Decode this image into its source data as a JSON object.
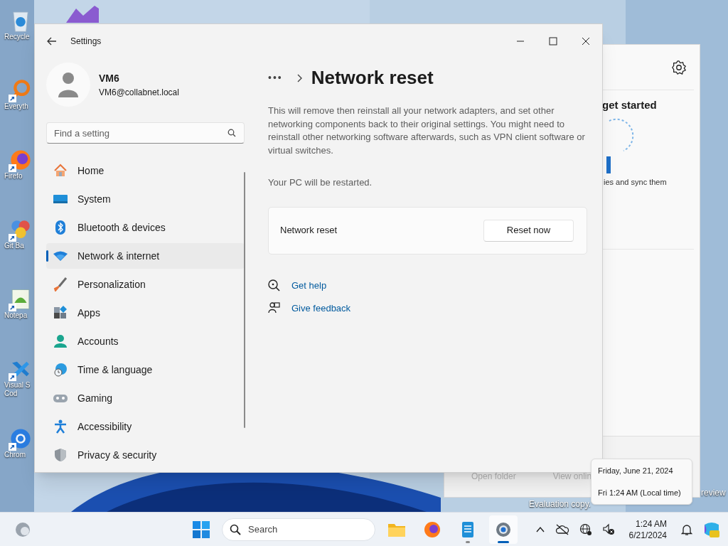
{
  "desktop_icons": [
    {
      "kind": "recycle",
      "lines": [
        "Recycle"
      ]
    },
    {
      "kind": "magnifier",
      "lines": [
        "Everyth"
      ]
    },
    {
      "kind": "firefox",
      "lines": [
        "Firefo"
      ]
    },
    {
      "kind": "git",
      "lines": [
        "Git Ba"
      ]
    },
    {
      "kind": "notepad",
      "lines": [
        "Notepa"
      ]
    },
    {
      "kind": "vscode",
      "lines": [
        "Visual S",
        "Cod"
      ]
    },
    {
      "kind": "chrome",
      "lines": [
        "Chrom"
      ]
    }
  ],
  "background_window": {
    "heading": "get started",
    "text": "ies and sync them",
    "actions": [
      {
        "label": "Open folder",
        "disabled": true
      },
      {
        "label": "View onlin",
        "disabled": true
      }
    ]
  },
  "desktop_watermark": [
    "review",
    "Evaluation copy."
  ],
  "settings_window": {
    "title": "Settings",
    "user": {
      "name": "VM6",
      "email": "VM6@collabnet.local"
    },
    "search": {
      "placeholder": "Find a setting"
    },
    "nav": [
      {
        "kind": "home",
        "label": "Home",
        "selected": false
      },
      {
        "kind": "system",
        "label": "System",
        "selected": false
      },
      {
        "kind": "bluetooth",
        "label": "Bluetooth & devices",
        "selected": false
      },
      {
        "kind": "wifi",
        "label": "Network & internet",
        "selected": true
      },
      {
        "kind": "brush",
        "label": "Personalization",
        "selected": false
      },
      {
        "kind": "apps",
        "label": "Apps",
        "selected": false
      },
      {
        "kind": "person",
        "label": "Accounts",
        "selected": false
      },
      {
        "kind": "clock",
        "label": "Time & language",
        "selected": false
      },
      {
        "kind": "gamepad",
        "label": "Gaming",
        "selected": false
      },
      {
        "kind": "accessibility",
        "label": "Accessibility",
        "selected": false
      },
      {
        "kind": "shield",
        "label": "Privacy & security",
        "selected": false
      }
    ],
    "page": {
      "breadcrumb_more": "•••",
      "title": "Network reset",
      "description": "This will remove then reinstall all your network adapters, and set other networking components back to their original settings. You might need to reinstall other networking software afterwards, such as VPN client software or virtual switches.",
      "note": "Your PC will be restarted.",
      "card": {
        "label": "Network reset",
        "button": "Reset now"
      },
      "links": [
        {
          "kind": "help",
          "label": "Get help"
        },
        {
          "kind": "feedback",
          "label": "Give feedback"
        }
      ]
    }
  },
  "taskbar": {
    "search_placeholder": "Search",
    "apps": [
      {
        "kind": "folder",
        "running": false,
        "selected": false
      },
      {
        "kind": "firefox",
        "running": false,
        "selected": false
      },
      {
        "kind": "notepad",
        "running": true,
        "selected": false
      },
      {
        "kind": "settings",
        "running": true,
        "selected": true
      }
    ],
    "time": "1:24 AM",
    "date": "6/21/2024"
  },
  "clock_tooltip": [
    "Friday, June 21, 2024",
    "Fri 1:24 AM (Local time)"
  ]
}
